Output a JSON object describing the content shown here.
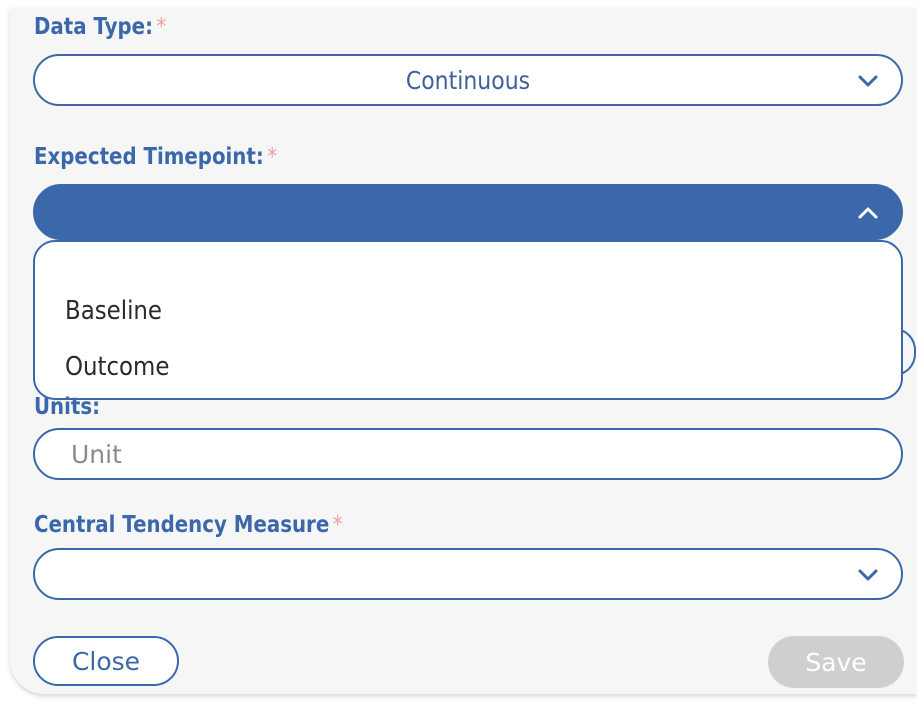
{
  "form": {
    "data_type": {
      "label": "Data Type:",
      "required_mark": "*",
      "selected_value": "Continuous",
      "chevron": "chevron-down-icon"
    },
    "expected_timepoint": {
      "label": "Expected Timepoint:",
      "required_mark": "*",
      "selected_value": "",
      "chevron": "chevron-up-icon",
      "state": "open",
      "options": [
        "Baseline",
        "Outcome"
      ]
    },
    "units": {
      "label": "Units:",
      "placeholder": "Unit",
      "value": ""
    },
    "central_tendency": {
      "label": "Central Tendency Measure",
      "required_mark": "*",
      "selected_value": "",
      "chevron": "chevron-down-icon"
    }
  },
  "actions": {
    "close_label": "Close",
    "save_label": "Save",
    "save_state": "disabled"
  },
  "colors": {
    "primary": "#3b68aa",
    "required": "#ef9f9f",
    "panel_bg": "#f6f6f6",
    "disabled_button": "#cfcfcf"
  }
}
